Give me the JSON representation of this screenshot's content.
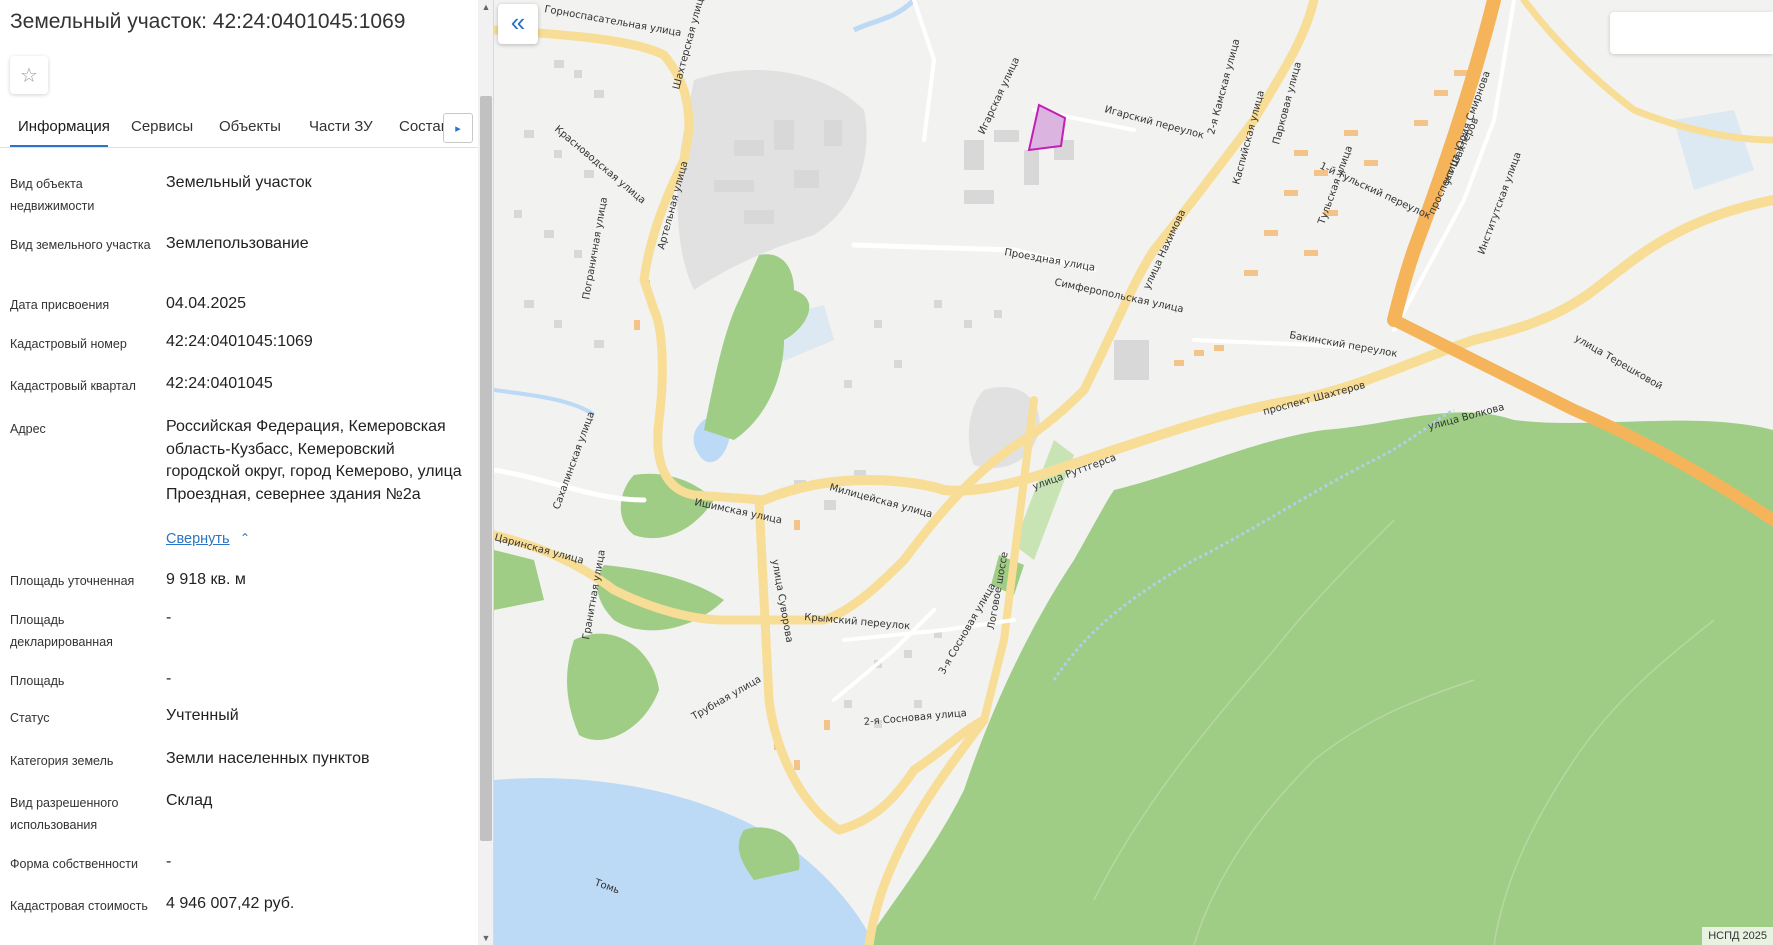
{
  "panel": {
    "title": "Земельный участок: 42:24:0401045:1069",
    "favorite_icon": "☆",
    "tabs": [
      "Информация",
      "Сервисы",
      "Объекты",
      "Части ЗУ",
      "Состав"
    ],
    "tabs_next_icon": "▸",
    "attributes": [
      {
        "label": "Вид объекта недвижимости",
        "value": "Земельный участок"
      },
      {
        "label": "Вид земельного участка",
        "value": "Землепользование"
      },
      {
        "label": "Дата присвоения",
        "value": "04.04.2025"
      },
      {
        "label": "Кадастровый номер",
        "value": "42:24:0401045:1069"
      },
      {
        "label": "Кадастровый квартал",
        "value": "42:24:0401045"
      },
      {
        "label": "Адрес",
        "value": "Российская Федерация, Кемеровская область-Кузбасс, Кемеровский городской округ, город Кемерово, улица Проездная, севернее здания №2а"
      },
      {
        "label": "Площадь уточненная",
        "value": "9 918 кв. м"
      },
      {
        "label": "Площадь декларированная",
        "value": "-"
      },
      {
        "label": "Площадь",
        "value": "-"
      },
      {
        "label": "Статус",
        "value": "Учтенный"
      },
      {
        "label": "Категория земель",
        "value": "Земли населенных пунктов"
      },
      {
        "label": "Вид разрешенного использования",
        "value": "Склад"
      },
      {
        "label": "Форма собственности",
        "value": "-"
      },
      {
        "label": "Кадастровая стоимость",
        "value": "4 946 007,42 руб."
      }
    ],
    "collapse_link": "Свернуть",
    "collapse_icon": "⌃"
  },
  "scrollbar": {
    "up_icon": "▲",
    "down_icon": "▼"
  },
  "map": {
    "collapse_panel_icon": "«",
    "copyright": "НСПД 2025",
    "colors": {
      "background": "#f2f2f0",
      "forest": "#9fcd85",
      "water": "#bcd9f5",
      "road": "#f8dd97",
      "major_road": "#f5b45a",
      "parcel": "#c21fb6"
    },
    "street_labels": [
      "Горноспасательная улица",
      "Артельная улица",
      "Шахтерская улица",
      "Игарская улица",
      "Игарский переулок",
      "2-я Камская улица",
      "Парковая улица",
      "Каспийская улица",
      "улица Нахимова",
      "проспект Шахтёров",
      "Проездная улица",
      "Симферопольская улица",
      "1-й Тульский переулок",
      "Тульская улица",
      "улица Юрия Смирнова",
      "Институтская улица",
      "улица Терешковой",
      "Бакинский переулок",
      "проспект Шахтеров",
      "улица Волкова",
      "улица Руттгерса",
      "Милицейская улица",
      "Ишимская улица",
      "Красноводская улица",
      "Пограничная улица",
      "улица Суворова",
      "Крымский переулок",
      "Логовое шоссе",
      "2-я Сосновая улица",
      "3-я Сосновая улица",
      "Трубная улица",
      "Гранитная улица",
      "Царинская улица",
      "Сахалинская улица",
      "Томь"
    ]
  }
}
